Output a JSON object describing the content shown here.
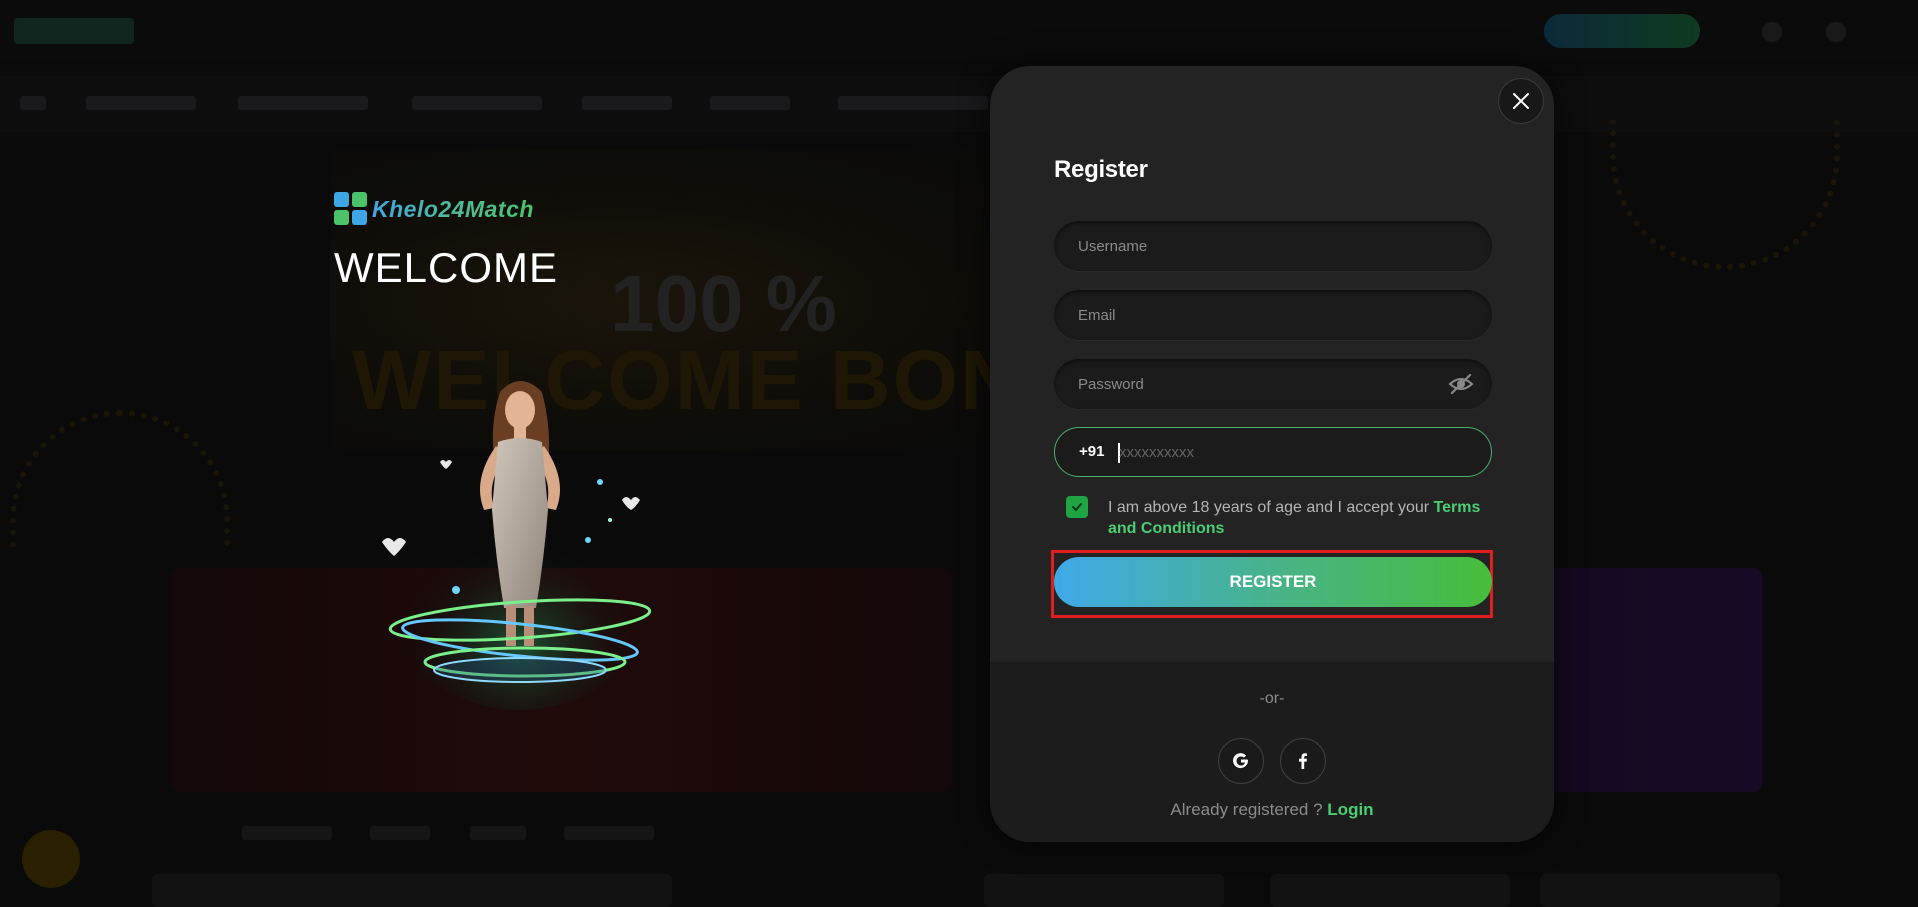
{
  "brand": {
    "name": "Khelo24Match"
  },
  "welcome": {
    "title": "WELCOME"
  },
  "background": {
    "banner_line1": "100 %",
    "banner_line2": "WELCOME BONU"
  },
  "modal": {
    "title": "Register",
    "close_icon": "close-icon",
    "fields": {
      "username_placeholder": "Username",
      "email_placeholder": "Email",
      "password_placeholder": "Password",
      "password_toggle_icon": "eye-off-icon",
      "phone_code": "+91",
      "phone_placeholder": "xxxxxxxxxx"
    },
    "consent": {
      "checked": true,
      "text": "I am above 18 years of age and I accept your ",
      "link": "Terms and Conditions"
    },
    "register_label": "REGISTER",
    "or_text": "-or-",
    "social": [
      "google-icon",
      "facebook-icon"
    ],
    "login_prompt": "Already registered ? ",
    "login_link": "Login"
  },
  "colors": {
    "accent_green": "#4ccd73",
    "checkbox_green": "#1fa443",
    "button_gradient_start": "#3fa9ea",
    "button_gradient_end": "#47bd3a",
    "highlight_red": "#e01e1e",
    "modal_bg": "#232323"
  }
}
